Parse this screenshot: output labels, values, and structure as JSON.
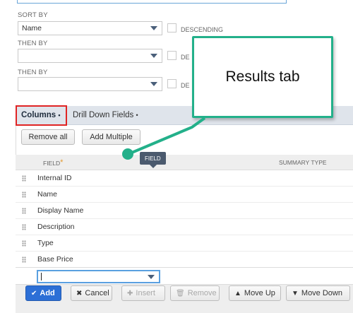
{
  "sort": {
    "sort_by_label": "SORT BY",
    "sort_by_value": "Name",
    "descending_label": "DESCENDING",
    "then_by_1_label": "THEN BY",
    "then_by_1_value": "",
    "then_by_1_desc_label": "DE",
    "then_by_2_label": "THEN BY",
    "then_by_2_value": "",
    "then_by_2_desc_label": "DE"
  },
  "callout": {
    "text": "Results tab",
    "border_color": "#23b08a"
  },
  "tabs": [
    {
      "label": "Columns",
      "suffix": "•",
      "active": true
    },
    {
      "label": "Drill Down Fields",
      "suffix": "•",
      "active": false
    }
  ],
  "toolbar": {
    "remove_all": "Remove all",
    "add_multiple": "Add Multiple"
  },
  "columns_header": {
    "field": "FIELD",
    "required_marker": "*",
    "summary_type": "SUMMARY TYPE",
    "tooltip": "FIELD"
  },
  "rows": [
    {
      "field": "Internal ID"
    },
    {
      "field": "Name"
    },
    {
      "field": "Display Name"
    },
    {
      "field": "Description"
    },
    {
      "field": "Type"
    },
    {
      "field": "Base Price"
    }
  ],
  "actions": {
    "add": "Add",
    "cancel": "Cancel",
    "insert": "Insert",
    "remove": "Remove",
    "move_up": "Move Up",
    "move_down": "Move Down"
  },
  "icons": {
    "add": "check-icon",
    "cancel": "x-icon",
    "insert": "plus-icon",
    "remove": "trash-icon",
    "move_up": "triangle-up-icon",
    "move_down": "triangle-down-icon"
  },
  "colors": {
    "primary": "#2c6fd6",
    "highlight": "#e02424",
    "tab_bar": "#dfe4eb"
  }
}
